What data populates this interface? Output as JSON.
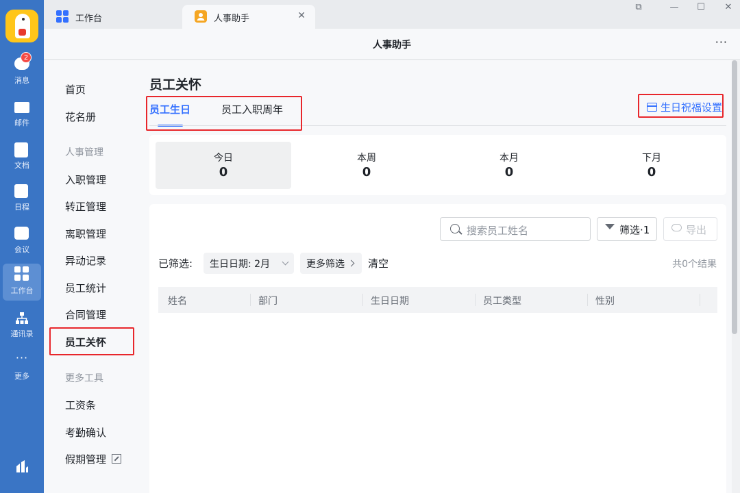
{
  "sidebar_rail": {
    "items": [
      {
        "label": "消息",
        "icon": "chat-icon",
        "badge": "2"
      },
      {
        "label": "邮件",
        "icon": "mail-icon"
      },
      {
        "label": "文档",
        "icon": "document-icon"
      },
      {
        "label": "日程",
        "icon": "calendar-icon"
      },
      {
        "label": "会议",
        "icon": "meeting-icon"
      },
      {
        "label": "工作台",
        "icon": "workplace-grid-icon",
        "active": true
      },
      {
        "label": "通讯录",
        "icon": "contacts-icon"
      },
      {
        "label": "更多",
        "icon": "more-icon"
      }
    ]
  },
  "tabs": [
    {
      "label": "工作台",
      "icon": "workplace-grid-icon"
    },
    {
      "label": "人事助手",
      "icon": "hr-assistant-icon",
      "active": true,
      "close": "✕"
    }
  ],
  "window_controls": {
    "restore": "⧉",
    "minimize": "—",
    "maximize": "☐",
    "close": "✕"
  },
  "header": {
    "title": "人事助手",
    "more": "···"
  },
  "menu": {
    "items": [
      {
        "label": "首页"
      },
      {
        "label": "花名册"
      },
      {
        "group": "人事管理"
      },
      {
        "label": "入职管理"
      },
      {
        "label": "转正管理"
      },
      {
        "label": "离职管理"
      },
      {
        "label": "异动记录"
      },
      {
        "label": "员工统计"
      },
      {
        "label": "合同管理"
      },
      {
        "label": "员工关怀",
        "active": true
      },
      {
        "group": "更多工具"
      },
      {
        "label": "工资条"
      },
      {
        "label": "考勤确认"
      },
      {
        "label": "假期管理",
        "external": true
      }
    ]
  },
  "page": {
    "title": "员工关怀",
    "tabs": [
      {
        "label": "员工生日",
        "active": true
      },
      {
        "label": "员工入职周年"
      }
    ],
    "birthday_settings_link": "生日祝福设置",
    "stats": [
      {
        "label": "今日",
        "value": "0",
        "selected": true
      },
      {
        "label": "本周",
        "value": "0"
      },
      {
        "label": "本月",
        "value": "0"
      },
      {
        "label": "下月",
        "value": "0"
      }
    ],
    "search": {
      "placeholder": "搜索员工姓名",
      "value": ""
    },
    "filter_button": "筛选·1",
    "export_button": "导出",
    "filtered_label": "已筛选:",
    "filter_chips": {
      "birthday_date": "生日日期: 2月",
      "more_filters": "更多筛选"
    },
    "clear": "清空",
    "result_count": "共0个结果",
    "table": {
      "columns": [
        "姓名",
        "部门",
        "生日日期",
        "员工类型",
        "性别"
      ],
      "rows": []
    }
  },
  "colors": {
    "rail": "#3a75c5",
    "accent": "#3370ff",
    "highlight": "#e8262b",
    "badge": "#f54a45"
  }
}
